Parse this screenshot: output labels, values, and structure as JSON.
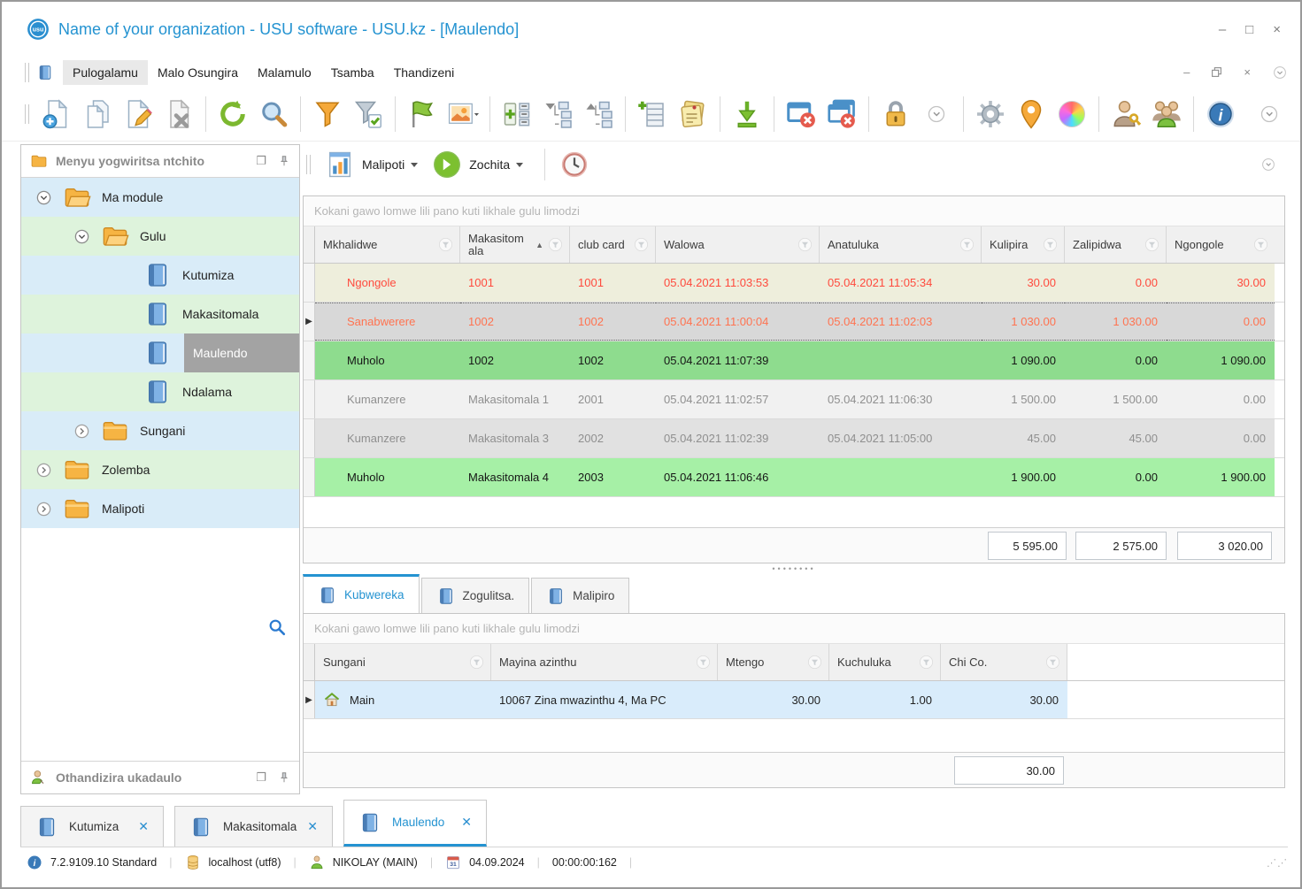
{
  "window": {
    "title": "Name of your organization - USU software - USU.kz - [Maulendo]",
    "logo_text": "usu",
    "controls": {
      "minimize": "–",
      "maximize": "□",
      "close": "×"
    }
  },
  "menu": {
    "items": [
      {
        "label": "Pulogalamu",
        "active": true
      },
      {
        "label": "Malo Osungira",
        "active": false
      },
      {
        "label": "Malamulo",
        "active": false
      },
      {
        "label": "Tsamba",
        "active": false
      },
      {
        "label": "Thandizeni",
        "active": false
      }
    ]
  },
  "toolbar": {
    "icons": [
      "new-document",
      "copy-document",
      "edit-document",
      "delete-document",
      "refresh",
      "search",
      "filter",
      "apply-filter",
      "flag",
      "image",
      "expand-groups",
      "collapse-tree",
      "expand-tree",
      "add-row",
      "notes",
      "export-download",
      "close-window",
      "close-all-windows",
      "lock",
      "more-chevron",
      "settings-gear",
      "location-pin",
      "color-wheel",
      "user-access",
      "users-group",
      "info",
      "more-chevron"
    ]
  },
  "report_bar": {
    "reports_label": "Malipoti",
    "actions_label": "Zochita",
    "icons": [
      "report-document",
      "run-action",
      "clock"
    ]
  },
  "sidebar": {
    "header": "Menyu yogwiritsa ntchito",
    "support_header": "Othandizira ukadaulo",
    "tree": [
      {
        "label": "Ma module",
        "level": 0,
        "icon": "folder-open",
        "expanded": true,
        "row": "blue"
      },
      {
        "label": "Gulu",
        "level": 1,
        "icon": "folder-open",
        "expanded": true,
        "row": "green"
      },
      {
        "label": "Kutumiza",
        "level": 2,
        "icon": "book",
        "row": "blue"
      },
      {
        "label": "Makasitomala",
        "level": 2,
        "icon": "book",
        "row": "green"
      },
      {
        "label": "Maulendo",
        "level": 2,
        "icon": "book",
        "row": "blue",
        "selected": true
      },
      {
        "label": "Ndalama",
        "level": 2,
        "icon": "book",
        "row": "green"
      },
      {
        "label": "Sungani",
        "level": 1,
        "icon": "folder",
        "expanded": false,
        "row": "blue"
      },
      {
        "label": "Zolemba",
        "level": 0,
        "icon": "folder",
        "expanded": false,
        "row": "green"
      },
      {
        "label": "Malipoti",
        "level": 0,
        "icon": "folder",
        "expanded": false,
        "row": "blue"
      }
    ]
  },
  "main_table": {
    "group_hint": "Kokani gawo lomwe lili pano kuti likhale gulu limodzi",
    "columns": [
      "Mkhalidwe",
      "Makasitomala",
      "club card",
      "Walowa",
      "Anatuluka",
      "Kulipira",
      "Zalipidwa",
      "Ngongole"
    ],
    "sort": {
      "column": "Makasitomala",
      "direction": "asc"
    },
    "rows": [
      {
        "status": "debt",
        "cells": [
          "Ngongole",
          "1001",
          "1001",
          "05.04.2021 11:03:53",
          "05.04.2021 11:05:34",
          "30.00",
          "0.00",
          "30.00"
        ]
      },
      {
        "status": "no-return-selected",
        "cells": [
          "Sanabwerere",
          "1002",
          "1002",
          "05.04.2021 11:00:04",
          "05.04.2021 11:02:03",
          "1 030.00",
          "1 030.00",
          "0.00"
        ]
      },
      {
        "status": "paid",
        "cells": [
          "Muholo",
          "1002",
          "1002",
          "05.04.2021 11:07:39",
          "",
          "1 090.00",
          "0.00",
          "1 090.00"
        ]
      },
      {
        "status": "left",
        "cells": [
          "Kumanzere",
          "Makasitomala 1",
          "2001",
          "05.04.2021 11:02:57",
          "05.04.2021 11:06:30",
          "1 500.00",
          "1 500.00",
          "0.00"
        ]
      },
      {
        "status": "left",
        "cells": [
          "Kumanzere",
          "Makasitomala 3",
          "2002",
          "05.04.2021 11:02:39",
          "05.04.2021 11:05:00",
          "45.00",
          "45.00",
          "0.00"
        ]
      },
      {
        "status": "paid",
        "cells": [
          "Muholo",
          "Makasitomala 4",
          "2003",
          "05.04.2021 11:06:46",
          "",
          "1 900.00",
          "0.00",
          "1 900.00"
        ]
      }
    ],
    "totals": [
      "5 595.00",
      "2 575.00",
      "3 020.00"
    ]
  },
  "detail": {
    "tabs": [
      {
        "label": "Kubwereka",
        "active": true
      },
      {
        "label": "Zogulitsa.",
        "active": false
      },
      {
        "label": "Malipiro",
        "active": false
      }
    ],
    "group_hint": "Kokani gawo lomwe lili pano kuti likhale gulu limodzi",
    "columns": [
      "Sungani",
      "Mayina azinthu",
      "Mtengo",
      "Kuchuluka",
      "Chi Co."
    ],
    "rows": [
      {
        "icon": "house",
        "cells": [
          "Main",
          "10067 Zina mwazinthu 4, Ma PC",
          "30.00",
          "1.00",
          "30.00"
        ]
      }
    ],
    "total": "30.00"
  },
  "doc_tabs": [
    {
      "label": "Kutumiza",
      "active": false
    },
    {
      "label": "Makasitomala",
      "active": false
    },
    {
      "label": "Maulendo",
      "active": true
    }
  ],
  "statusbar": {
    "version": "7.2.9109.10 Standard",
    "database": "localhost (utf8)",
    "user": "NIKOLAY (MAIN)",
    "calendar_day": "31",
    "date": "04.09.2024",
    "timer": "00:00:00:162"
  },
  "colors": {
    "accent_blue": "#2493d1",
    "row_debt_bg": "#eeeedc",
    "row_debt_text": "#ff4a3d",
    "row_selected_bg": "#d8d8d8",
    "row_selected_text": "#ff7350",
    "row_paid_bg": "#8edc8e",
    "row_paid_light_bg": "#a6f0a6",
    "row_left_bg": "#f1f1f1",
    "row_left_dark_bg": "#e1e1e1",
    "row_left_text": "#8f8f8f",
    "tree_blue": "#d9ecf8",
    "tree_green": "#def3dc",
    "tree_selected": "#a3a3a3",
    "detail_row_bg": "#d9ecfb"
  }
}
